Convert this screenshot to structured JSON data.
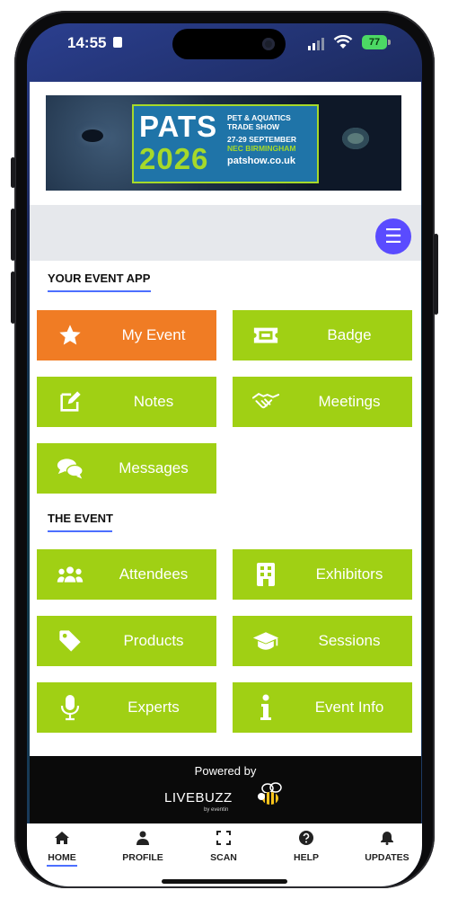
{
  "status": {
    "time": "14:55",
    "battery": "77"
  },
  "banner": {
    "title": "PATS",
    "year": "2026",
    "subtitle_line1": "PET & AQUATICS",
    "subtitle_line2": "TRADE SHOW",
    "dates": "27-29 SEPTEMBER",
    "venue": "NEC BIRMINGHAM",
    "website": "patshow.co.uk"
  },
  "sections": {
    "event_app": {
      "title": "YOUR EVENT APP",
      "tiles": [
        {
          "label": "My Event",
          "icon": "star-icon",
          "color": "#f07c24"
        },
        {
          "label": "Badge",
          "icon": "ticket-icon",
          "color": "#a0d014"
        },
        {
          "label": "Notes",
          "icon": "edit-note-icon",
          "color": "#a0d014"
        },
        {
          "label": "Meetings",
          "icon": "handshake-icon",
          "color": "#a0d014"
        },
        {
          "label": "Messages",
          "icon": "chat-bubbles-icon",
          "color": "#a0d014"
        }
      ]
    },
    "the_event": {
      "title": "THE EVENT",
      "tiles": [
        {
          "label": "Attendees",
          "icon": "people-icon",
          "color": "#a0d014"
        },
        {
          "label": "Exhibitors",
          "icon": "building-icon",
          "color": "#a0d014"
        },
        {
          "label": "Products",
          "icon": "tag-icon",
          "color": "#a0d014"
        },
        {
          "label": "Sessions",
          "icon": "graduation-cap-icon",
          "color": "#a0d014"
        },
        {
          "label": "Experts",
          "icon": "microphone-icon",
          "color": "#a0d014"
        },
        {
          "label": "Event Info",
          "icon": "info-icon",
          "color": "#a0d014"
        }
      ]
    }
  },
  "footer": {
    "powered_by": "Powered by",
    "brand": "LIVEBUZZ",
    "brand_sub": "by eventin"
  },
  "tabs": [
    {
      "label": "HOME",
      "icon": "home-icon",
      "active": true
    },
    {
      "label": "PROFILE",
      "icon": "person-icon",
      "active": false
    },
    {
      "label": "SCAN",
      "icon": "scan-icon",
      "active": false
    },
    {
      "label": "HELP",
      "icon": "help-icon",
      "active": false
    },
    {
      "label": "UPDATES",
      "icon": "bell-icon",
      "active": false
    }
  ],
  "colors": {
    "accent": "#5a4bff",
    "tile_green": "#a0d014",
    "tile_orange": "#f07c24",
    "underline_blue": "#4c6fff"
  }
}
